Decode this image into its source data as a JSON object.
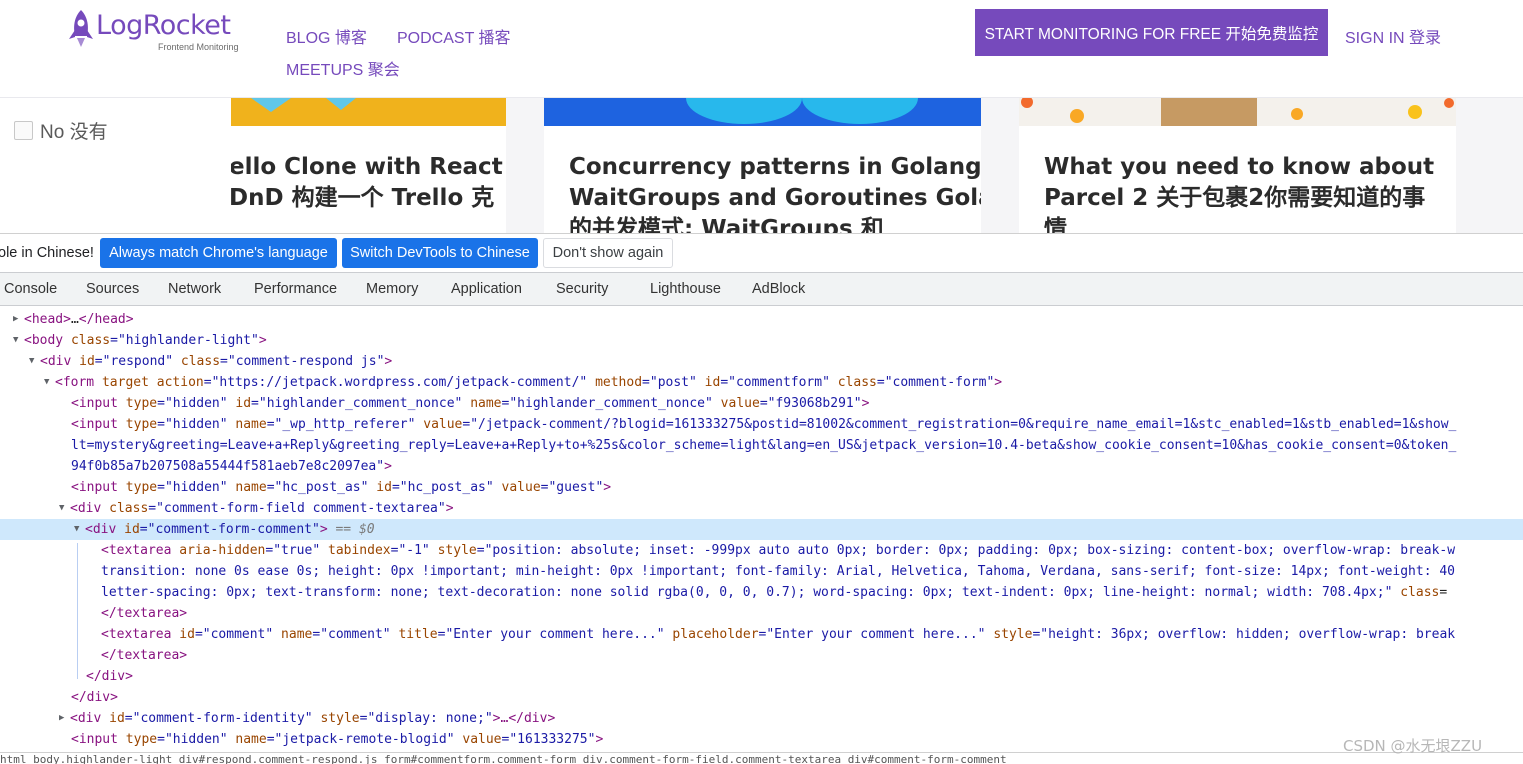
{
  "header": {
    "logo_text": "LogRocket",
    "logo_tagline": "Frontend Monitoring",
    "nav": {
      "blog": "BLOG 博客",
      "podcast": "PODCAST 播客",
      "meetups": "MEETUPS 聚会"
    },
    "cta_label": "START MONITORING FOR FREE 开始免费监控",
    "signin_label": "SIGN IN 登录",
    "brand_color": "#764abc"
  },
  "page": {
    "checkbox_label": "No 没有",
    "cards": [
      {
        "title_line1": "ello Clone with React",
        "title_line2": "DnD 构建一个 Trello 克"
      },
      {
        "title_line1": "Concurrency patterns in Golang:",
        "title_line2": "WaitGroups and Goroutines Golang",
        "title_line3": "的并发模式: WaitGroups 和"
      },
      {
        "title_line1": "What you need to know about",
        "title_line2": "Parcel 2 关于包裹2你需要知道的事",
        "title_line3": "情"
      }
    ]
  },
  "devtools": {
    "info_bar": {
      "message": "ole in Chinese!",
      "btn_match": "Always match Chrome's language",
      "btn_switch": "Switch DevTools to Chinese",
      "btn_dismiss": "Don't show again"
    },
    "tabs": [
      "Console",
      "Sources",
      "Network",
      "Performance",
      "Memory",
      "Application",
      "Security",
      "Lighthouse",
      "AdBlock"
    ],
    "lines": [
      {
        "t1": "<head>",
        "t2": "…",
        "t3": "</head>"
      },
      {
        "t1": "<body ",
        "a1": "class",
        "v1": "\"highlander-light\"",
        "t2": ">"
      },
      {
        "t1": "<div ",
        "a1": "id",
        "v1": "\"respond\"",
        "a2": "class",
        "v2": "\"comment-respond js\"",
        "t2": ">"
      },
      {
        "t1": "<form ",
        "a0": "target",
        "a1": "action",
        "v1": "\"https://jetpack.wordpress.com/jetpack-comment/\"",
        "a2": "method",
        "v2": "\"post\"",
        "a3": "id",
        "v3": "\"commentform\"",
        "a4": "class",
        "v4": "\"comment-form\"",
        "t2": ">"
      },
      {
        "t1": "<input ",
        "a1": "type",
        "v1": "\"hidden\"",
        "a2": "id",
        "v2": "\"highlander_comment_nonce\"",
        "a3": "name",
        "v3": "\"highlander_comment_nonce\"",
        "a4": "value",
        "v4": "\"f93068b291\"",
        "t2": ">"
      },
      {
        "t1": "<input ",
        "a1": "type",
        "v1": "\"hidden\"",
        "a2": "name",
        "v2": "\"_wp_http_referer\"",
        "a3": "value",
        "v3": "\"/jetpack-comment/?blogid=161333275&postid=81002&comment_registration=0&require_name_email=1&stc_enabled=1&stb_enabled=1&show_"
      },
      {
        "v1": "lt=mystery&greeting=Leave+a+Reply&greeting_reply=Leave+a+Reply+to+%25s&color_scheme=light&lang=en_US&jetpack_version=10.4-beta&show_cookie_consent=10&has_cookie_consent=0&token_"
      },
      {
        "v1": "94f0b85a7b207508a55444f581aeb7e8c2097ea\"",
        "t2": ">"
      },
      {
        "t1": "<input ",
        "a1": "type",
        "v1": "\"hidden\"",
        "a2": "name",
        "v2": "\"hc_post_as\"",
        "a3": "id",
        "v3": "\"hc_post_as\"",
        "a4": "value",
        "v4": "\"guest\"",
        "t2": ">"
      },
      {
        "t1": "<div ",
        "a1": "class",
        "v1": "\"comment-form-field comment-textarea\"",
        "t2": ">"
      },
      {
        "t1": "<div ",
        "a1": "id",
        "v1": "\"comment-form-comment\"",
        "t2": ">",
        "extra": " == $0"
      },
      {
        "t1": "<textarea ",
        "a1": "aria-hidden",
        "v1": "\"true\"",
        "a2": "tabindex",
        "v2": "\"-1\"",
        "a3": "style",
        "v3": "\"position: absolute; inset: -999px auto auto 0px; border: 0px; padding: 0px; box-sizing: content-box; overflow-wrap: break-w"
      },
      {
        "v1": "transition: none 0s ease 0s; height: 0px !important; min-height: 0px !important; font-family: Arial, Helvetica, Tahoma, Verdana, sans-serif; font-size: 14px; font-weight: 40"
      },
      {
        "v1": "letter-spacing: 0px; text-transform: none; text-decoration: none solid rgba(0, 0, 0, 0.7); word-spacing: 0px; text-indent: 0px; line-height: normal; width: 708.4px;\"",
        "a2": "class"
      },
      {
        "t1": "</textarea>"
      },
      {
        "t1": "<textarea ",
        "a1": "id",
        "v1": "\"comment\"",
        "a2": "name",
        "v2": "\"comment\"",
        "a3": "title",
        "v3": "\"Enter your comment here...\"",
        "a4": "placeholder",
        "v4": "\"Enter your comment here...\"",
        "a5": "style",
        "v5": "\"height: 36px; overflow: hidden; overflow-wrap: break"
      },
      {
        "t1": "</textarea>"
      },
      {
        "t1": "</div>"
      },
      {
        "t1": "</div>"
      },
      {
        "t1": "<div ",
        "a1": "id",
        "v1": "\"comment-form-identity\"",
        "a2": "style",
        "v2": "\"display: none;\"",
        "t2": ">…</div>"
      },
      {
        "t1": "<input ",
        "a1": "type",
        "v1": "\"hidden\"",
        "a2": "name",
        "v2": "\"jetpack-remote-blogid\"",
        "a3": "value",
        "v3": "\"161333275\"",
        "t2": ">"
      }
    ],
    "status_bar": "html  body.highlander-light  div#respond.comment-respond.js  form#commentform.comment-form  div.comment-form-field.comment-textarea  div#comment-form-comment"
  },
  "watermark": "CSDN @水无垠ZZU"
}
